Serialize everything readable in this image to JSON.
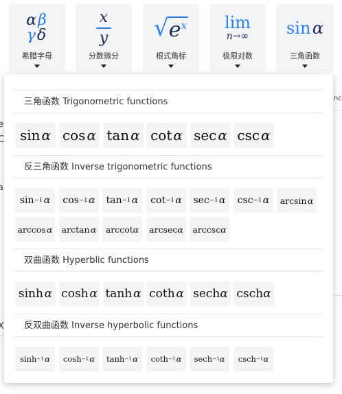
{
  "toolbar": {
    "buttons": [
      {
        "label": "希腊字母",
        "glyph": [
          "αβ",
          "γδ"
        ]
      },
      {
        "label": "分数微分",
        "glyph_num": "x",
        "glyph_den": "y"
      },
      {
        "label": "根式角标",
        "glyph_base": "e",
        "glyph_exp": "x"
      },
      {
        "label": "极限对数",
        "glyph_top": "lim",
        "glyph_sub": "n→∞"
      },
      {
        "label": "三角函数",
        "glyph_fn": "sin",
        "glyph_var": "α"
      }
    ]
  },
  "background": {
    "left_fragments": [
      "e",
      "C",
      "a",
      "X"
    ],
    "right_fragment": "nc"
  },
  "panel": {
    "sections": [
      {
        "title": "三角函数 Trigonometric functions",
        "items": [
          "sin",
          "cos",
          "tan",
          "cot",
          "sec",
          "csc"
        ]
      },
      {
        "title": "反三角函数 Inverse trigonometric functions",
        "items": [
          "sin",
          "cos",
          "tan",
          "cot",
          "sec",
          "csc",
          "arcsin",
          "arccos",
          "arctan",
          "arccot",
          "arcsec",
          "arccsc"
        ]
      },
      {
        "title": "双曲函数 Hyperblic functions",
        "items": [
          "sinh",
          "cosh",
          "tanh",
          "coth",
          "sech",
          "csch"
        ]
      },
      {
        "title": "反双曲函数 Inverse hyperbolic functions",
        "items": [
          "sinh",
          "cosh",
          "tanh",
          "coth",
          "sech",
          "csch"
        ]
      }
    ],
    "variable": "α",
    "inverse_exponent": "−1"
  }
}
